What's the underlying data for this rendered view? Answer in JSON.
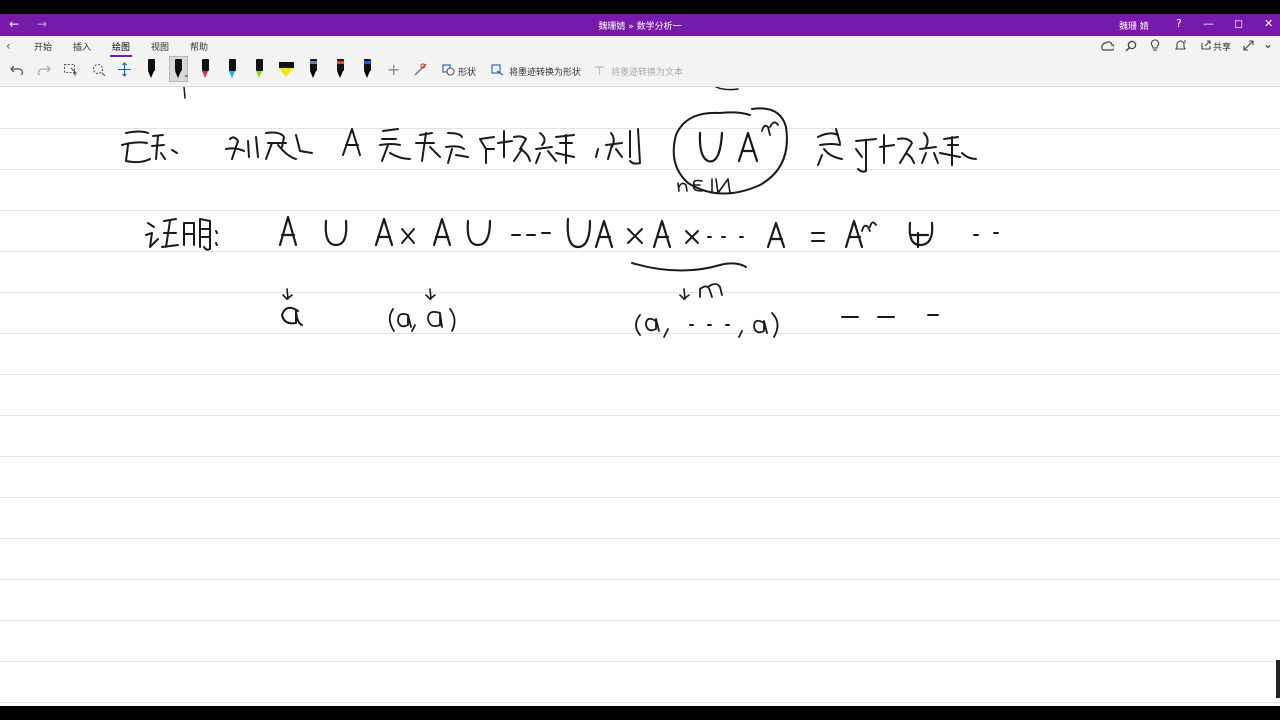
{
  "window": {
    "title": "魏珊婧 » 数学分析一",
    "user": "魏珊 婧",
    "back_icon": "arrow-left-icon",
    "forward_icon": "arrow-right-icon",
    "help_glyph": "?",
    "minimize_glyph": "—",
    "restore_glyph": "◻",
    "close_glyph": "✕"
  },
  "ribbon": {
    "tabs": [
      "开始",
      "插入",
      "绘图",
      "视图",
      "帮助"
    ],
    "active_tab": "绘图",
    "share_label": "共享",
    "shapes_label": "形状",
    "ink_to_shape_label": "将墨迹转换为形状",
    "ink_to_text_label": "将墨迹转换为文本",
    "pens": [
      {
        "kind": "pen",
        "color": "#111111"
      },
      {
        "kind": "pen",
        "color": "#111111",
        "selected": true
      },
      {
        "kind": "pen",
        "color": "#e0245e"
      },
      {
        "kind": "pen",
        "color": "#19b5d8"
      },
      {
        "kind": "pen",
        "color": "#9bd21c"
      },
      {
        "kind": "highlighter",
        "color": "#f7e600"
      },
      {
        "kind": "pen",
        "color": "#6b7fa8"
      },
      {
        "kind": "pen",
        "color": "#e8432b"
      },
      {
        "kind": "pen",
        "color": "#2f4fd6"
      }
    ]
  },
  "accent": "#7719aa"
}
